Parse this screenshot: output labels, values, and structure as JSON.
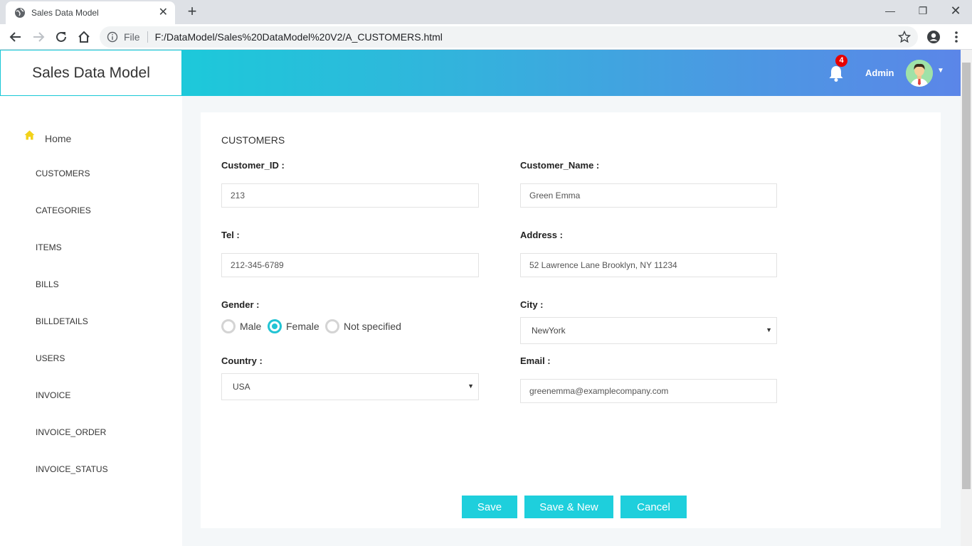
{
  "browser": {
    "tab_title": "Sales Data Model",
    "scheme_label": "File",
    "url": "F:/DataModel/Sales%20DataModel%20V2/A_CUSTOMERS.html"
  },
  "header": {
    "brand": "Sales Data Model",
    "notification_count": "4",
    "user_name": "Admin"
  },
  "sidebar": {
    "home_label": "Home",
    "items": [
      {
        "label": "CUSTOMERS"
      },
      {
        "label": "CATEGORIES"
      },
      {
        "label": "ITEMS"
      },
      {
        "label": "BILLS"
      },
      {
        "label": "BILLDETAILS"
      },
      {
        "label": "USERS"
      },
      {
        "label": "INVOICE"
      },
      {
        "label": "INVOICE_ORDER"
      },
      {
        "label": "INVOICE_STATUS"
      }
    ]
  },
  "form": {
    "title": "CUSTOMERS",
    "customer_id": {
      "label": "Customer_ID :",
      "value": "213"
    },
    "customer_name": {
      "label": "Customer_Name :",
      "value": "Green Emma"
    },
    "tel": {
      "label": "Tel :",
      "value": "212-345-6789"
    },
    "address": {
      "label": "Address :",
      "value": "52 Lawrence Lane Brooklyn, NY 11234"
    },
    "gender": {
      "label": "Gender :",
      "options": [
        {
          "label": "Male",
          "selected": false
        },
        {
          "label": "Female",
          "selected": true
        },
        {
          "label": "Not specified",
          "selected": false
        }
      ]
    },
    "city": {
      "label": "City :",
      "value": "NewYork"
    },
    "country": {
      "label": "Country :",
      "value": "USA"
    },
    "email": {
      "label": "Email :",
      "value": "greenemma@examplecompany.com"
    }
  },
  "buttons": {
    "save": "Save",
    "save_new": "Save & New",
    "cancel": "Cancel"
  },
  "colors": {
    "accent": "#1ecfdc",
    "badge": "#e60000",
    "home_icon": "#f2d21a"
  }
}
